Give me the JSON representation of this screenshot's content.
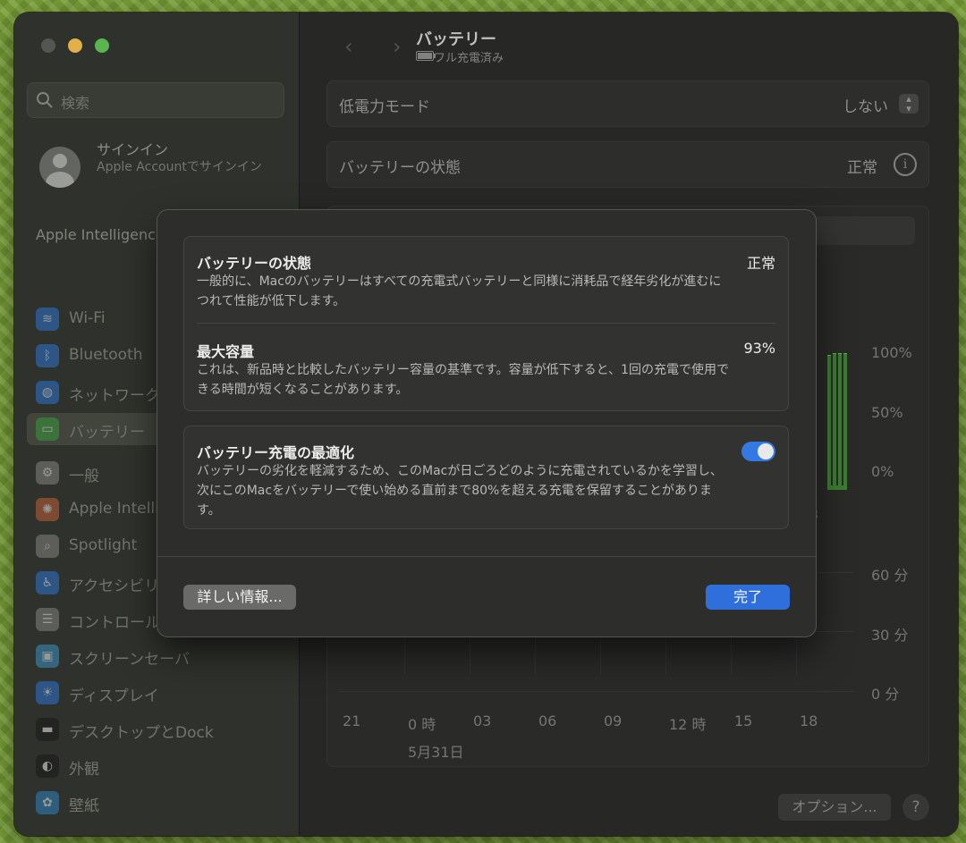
{
  "sidebar": {
    "search_placeholder": "検索",
    "account": {
      "title": "サインイン",
      "subtitle": "Apple Accountでサインイン"
    },
    "ai_banner": "Apple Intelligenceの準備ができました",
    "items": [
      {
        "label": "Wi-Fi",
        "icon": "wifi-icon",
        "color": "#2f7de1",
        "glyph": "≋"
      },
      {
        "label": "Bluetooth",
        "icon": "bluetooth-icon",
        "color": "#2f7de1",
        "glyph": "ᛒ"
      },
      {
        "label": "ネットワーク",
        "icon": "globe-icon",
        "color": "#2f7de1",
        "glyph": "◍"
      },
      {
        "label": "バッテリー",
        "icon": "battery-icon",
        "color": "#3ea640",
        "glyph": "▭",
        "selected": true
      },
      {
        "label": "一般",
        "icon": "gear-icon",
        "color": "#8e8e8b",
        "glyph": "⚙"
      },
      {
        "label": "Apple Intelligence",
        "icon": "apple-intelligence-icon",
        "color": "#d0683c",
        "glyph": "✺"
      },
      {
        "label": "Spotlight",
        "icon": "spotlight-icon",
        "color": "#8e8e8b",
        "glyph": "⌕"
      },
      {
        "label": "アクセシビリティ",
        "icon": "accessibility-icon",
        "color": "#2f7de1",
        "glyph": "♿"
      },
      {
        "label": "コントロールセンター",
        "icon": "control-center-icon",
        "color": "#8e8e8b",
        "glyph": "☰"
      },
      {
        "label": "スクリーンセーバ",
        "icon": "screensaver-icon",
        "color": "#3f9ed4",
        "glyph": "▣"
      },
      {
        "label": "ディスプレイ",
        "icon": "display-icon",
        "color": "#2f7de1",
        "glyph": "☀"
      },
      {
        "label": "デスクトップとDock",
        "icon": "dock-icon",
        "color": "#1d1d1d",
        "glyph": "▬"
      },
      {
        "label": "外観",
        "icon": "appearance-icon",
        "color": "#1d1d1d",
        "glyph": "◐"
      },
      {
        "label": "壁紙",
        "icon": "wallpaper-icon",
        "color": "#2f8fd0",
        "glyph": "✿"
      }
    ]
  },
  "main": {
    "title": "バッテリー",
    "subtitle": "フル充電済み",
    "low_power": {
      "label": "低電力モード",
      "value": "しない"
    },
    "health": {
      "label": "バッテリーの状態",
      "value": "正常"
    },
    "level_ticks": [
      "100%",
      "50%",
      "0%"
    ],
    "usage_ticks": [
      "60 分",
      "30 分",
      "0 分"
    ],
    "partial_label": "3",
    "time_ticks": [
      "21",
      "0 時",
      "03",
      "06",
      "09",
      "12 時",
      "15",
      "18"
    ],
    "date_label": "5月31日",
    "options_button": "オプション...",
    "help_button": "?"
  },
  "sheet": {
    "health": {
      "title": "バッテリーの状態",
      "value": "正常",
      "description": "一般的に、Macのバッテリーはすべての充電式バッテリーと同様に消耗品で経年劣化が進むにつれて性能が低下します。"
    },
    "capacity": {
      "title": "最大容量",
      "value": "93%",
      "description": "これは、新品時と比較したバッテリー容量の基準です。容量が低下すると、1回の充電で使用できる時間が短くなることがあります。"
    },
    "optimize": {
      "title": "バッテリー充電の最適化",
      "enabled": true,
      "description": "バッテリーの劣化を軽減するため、このMacが日ごろどのように充電されているかを学習し、次にこのMacをバッテリーで使い始める直前まで80%を超える充電を保留することがあります。"
    },
    "details_button": "詳しい情報...",
    "done_button": "完了"
  }
}
